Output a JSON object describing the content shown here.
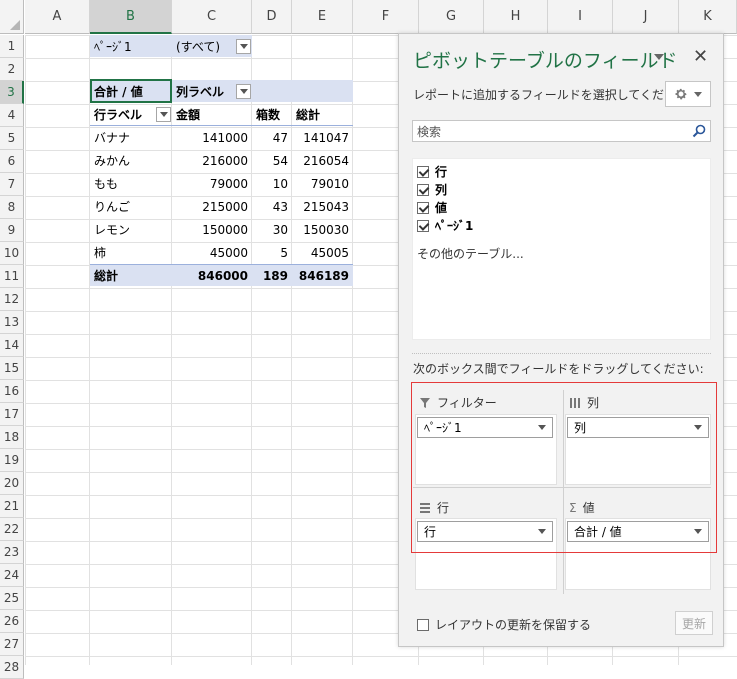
{
  "sheet": {
    "columns": [
      "A",
      "B",
      "C",
      "D",
      "E",
      "F",
      "G",
      "H",
      "I",
      "J",
      "K"
    ],
    "rows": [
      "1",
      "2",
      "3",
      "4",
      "5",
      "6",
      "7",
      "8",
      "9",
      "10",
      "11",
      "12",
      "13",
      "14",
      "15",
      "16",
      "17",
      "18",
      "19",
      "20",
      "21",
      "22",
      "23",
      "24",
      "25",
      "26",
      "27",
      "28"
    ],
    "selected_column": "B",
    "selected_row": "3"
  },
  "pivot": {
    "filter_label": "ﾍﾟｰｼﾞ1",
    "filter_value": "(すべて)",
    "corner_label": "合計 / 値",
    "col_labels": "列ラベル",
    "row_labels": "行ラベル",
    "headers": [
      "金額",
      "箱数",
      "総計"
    ],
    "rows": [
      {
        "label": "バナナ",
        "v1": "141000",
        "v2": "47",
        "total": "141047"
      },
      {
        "label": "みかん",
        "v1": "216000",
        "v2": "54",
        "total": "216054"
      },
      {
        "label": "もも",
        "v1": "79000",
        "v2": "10",
        "total": "79010"
      },
      {
        "label": "りんご",
        "v1": "215000",
        "v2": "43",
        "total": "215043"
      },
      {
        "label": "レモン",
        "v1": "150000",
        "v2": "30",
        "total": "150030"
      },
      {
        "label": "柿",
        "v1": "45000",
        "v2": "5",
        "total": "45005"
      }
    ],
    "grand": {
      "label": "総計",
      "v1": "846000",
      "v2": "189",
      "total": "846189"
    }
  },
  "panel": {
    "title": "ピボットテーブルのフィールド",
    "subtitle": "レポートに追加するフィールドを選択してください:",
    "search_placeholder": "検索",
    "fields": [
      {
        "label": "行",
        "checked": true
      },
      {
        "label": "列",
        "checked": true
      },
      {
        "label": "値",
        "checked": true
      },
      {
        "label": "ﾍﾟｰｼﾞ1",
        "checked": true
      }
    ],
    "other_tables": "その他のテーブル...",
    "drag_hint": "次のボックス間でフィールドをドラッグしてください:",
    "areas": {
      "filter": {
        "title": "フィルター",
        "chip": "ﾍﾟｰｼﾞ1"
      },
      "columns": {
        "title": "列",
        "chip": "列"
      },
      "rows": {
        "title": "行",
        "chip": "行"
      },
      "values": {
        "title": "値",
        "chip": "合計 / 値"
      }
    },
    "defer_label": "レイアウトの更新を保留する",
    "update_label": "更新"
  },
  "colors": {
    "accent": "#217346",
    "pivot_band": "#dae1f2",
    "highlight_border": "#e43a3a"
  }
}
